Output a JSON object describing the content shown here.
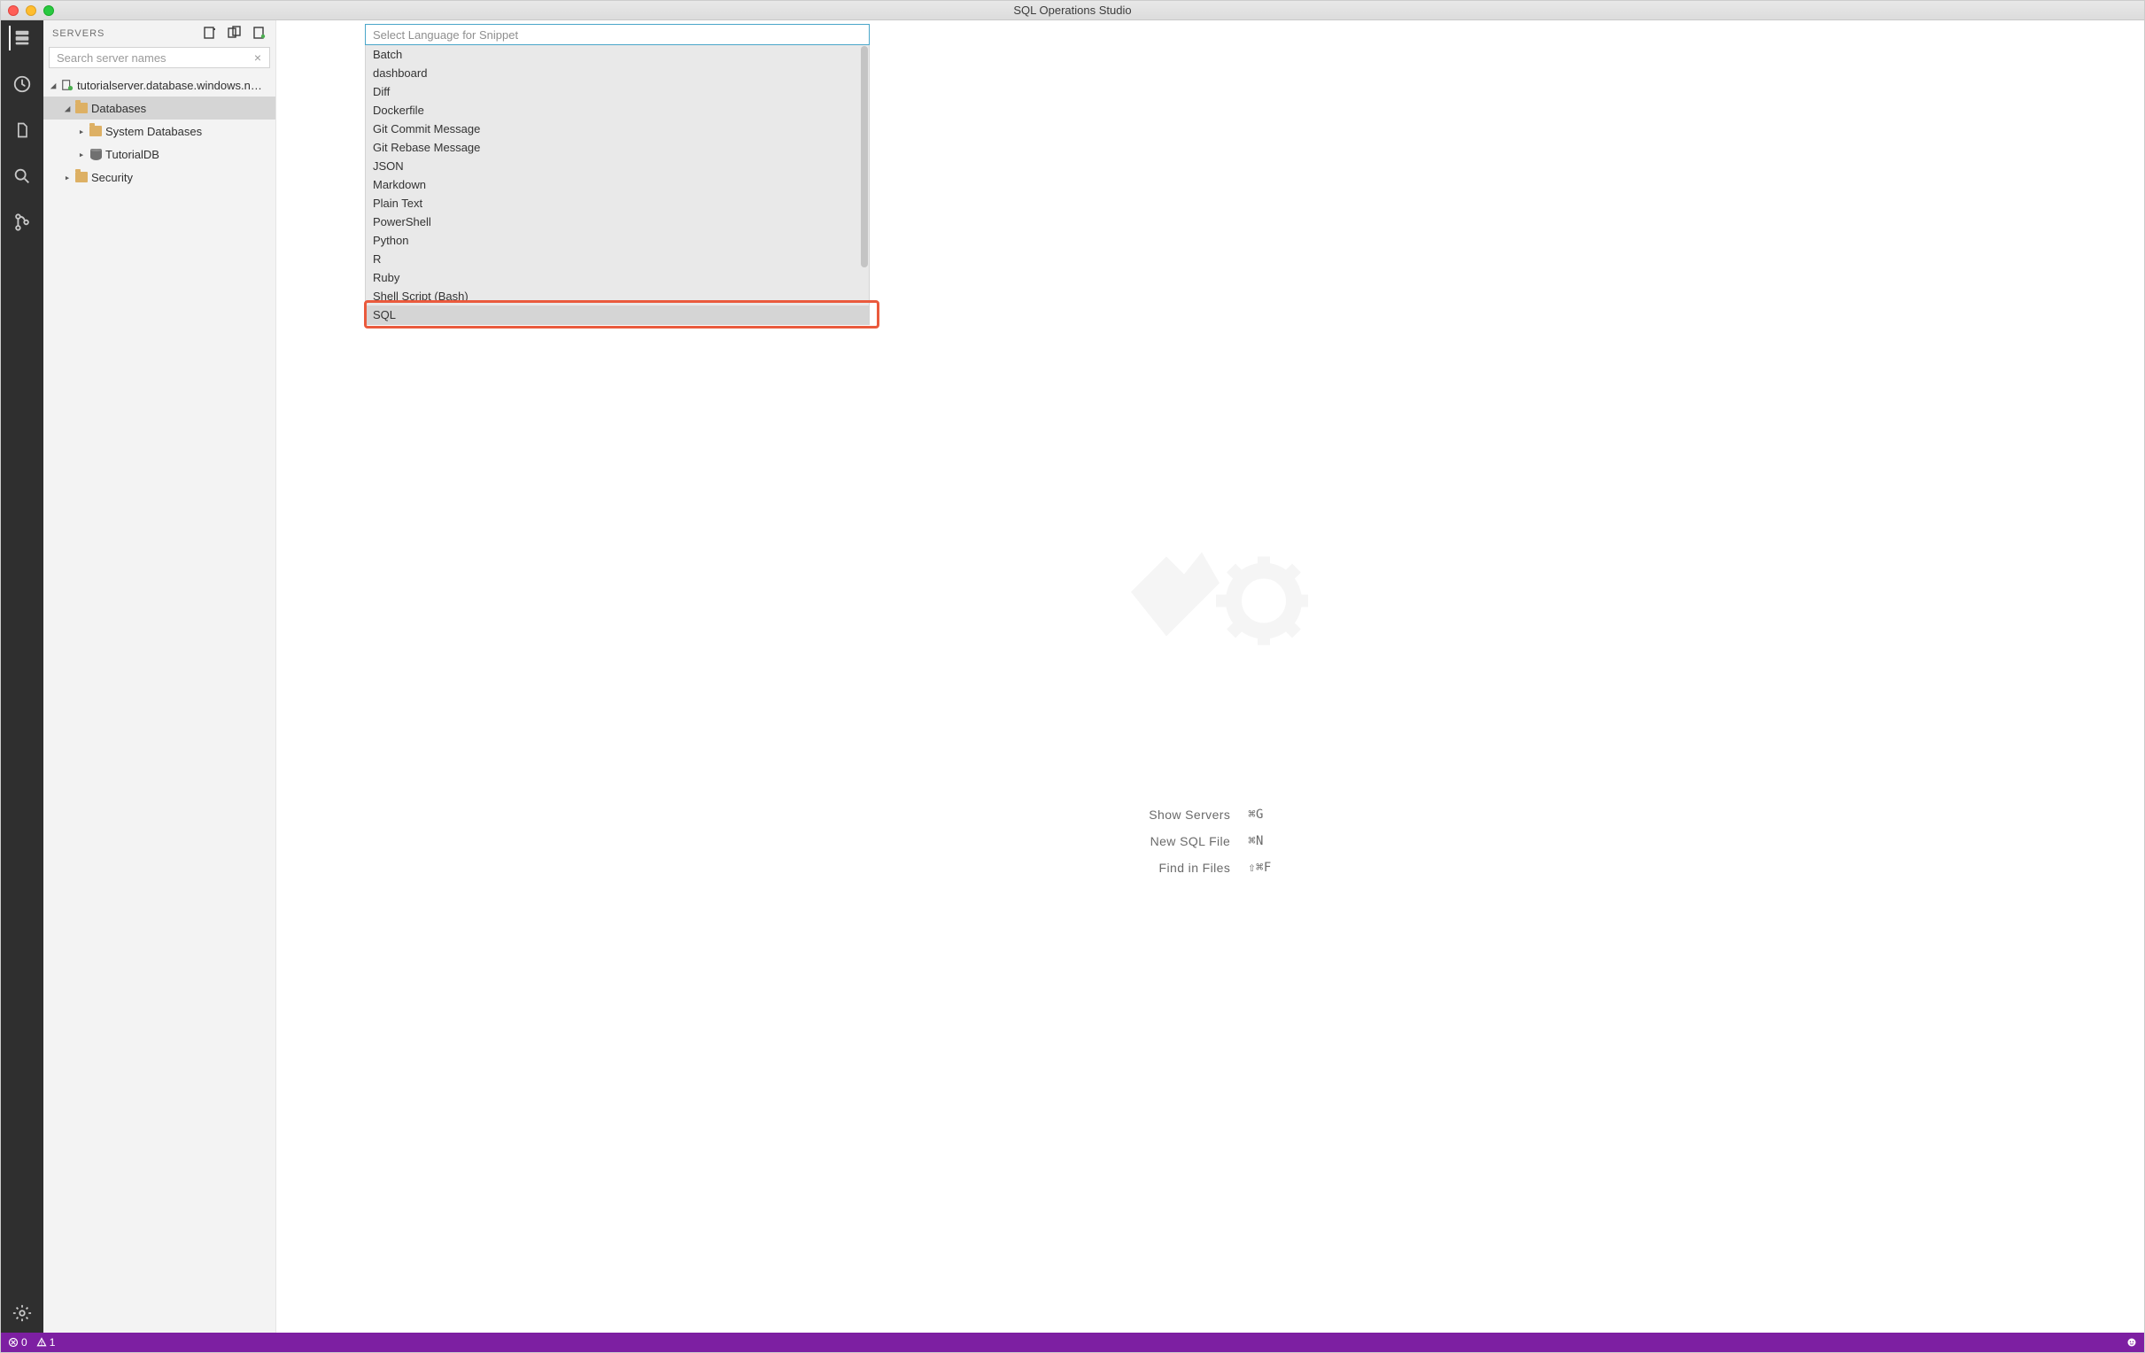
{
  "window": {
    "title": "SQL Operations Studio"
  },
  "sidebar": {
    "header": "SERVERS",
    "search_placeholder": "Search server names",
    "tree": {
      "server": "tutorialserver.database.windows.n…",
      "databases": "Databases",
      "system_dbs": "System Databases",
      "tutorialdb": "TutorialDB",
      "security": "Security"
    }
  },
  "quickpick": {
    "placeholder": "Select Language for Snippet",
    "items": [
      "Batch",
      "dashboard",
      "Diff",
      "Dockerfile",
      "Git Commit Message",
      "Git Rebase Message",
      "JSON",
      "Markdown",
      "Plain Text",
      "PowerShell",
      "Python",
      "R",
      "Ruby",
      "Shell Script (Bash)",
      "SQL"
    ],
    "highlighted_index": 14
  },
  "hints": {
    "rows": [
      {
        "label": "Show Servers",
        "key": "⌘G"
      },
      {
        "label": "New SQL File",
        "key": "⌘N"
      },
      {
        "label": "Find in Files",
        "key": "⇧⌘F"
      }
    ]
  },
  "statusbar": {
    "errors": "0",
    "warnings": "1"
  }
}
